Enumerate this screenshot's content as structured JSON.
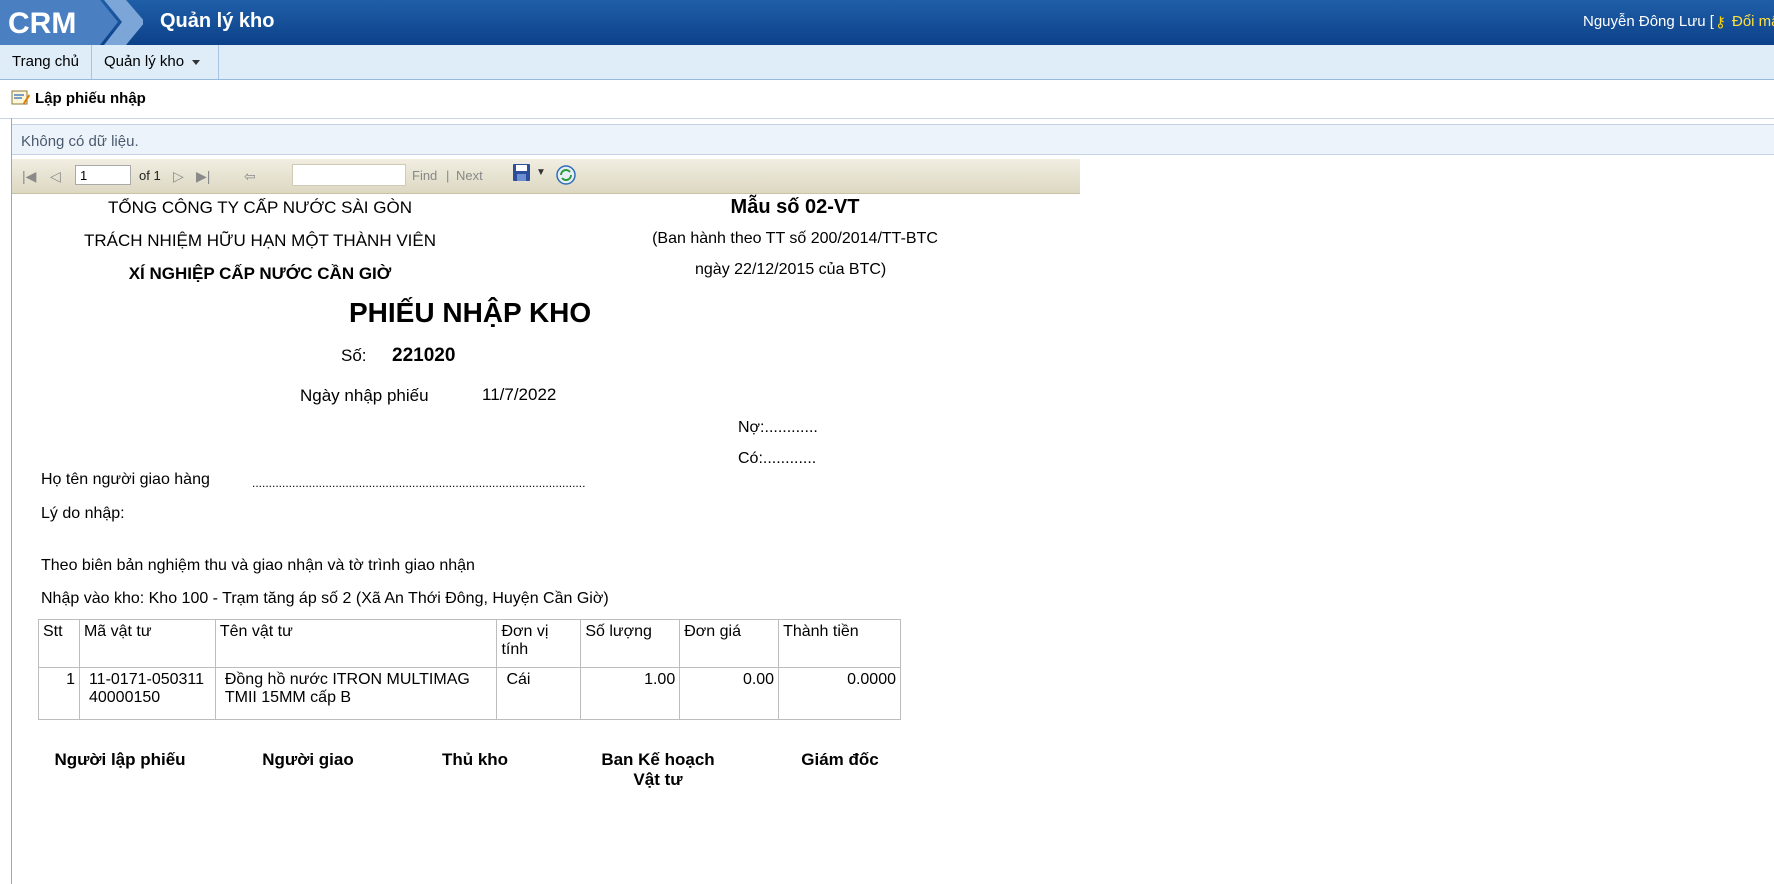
{
  "header": {
    "logo_text": "CRM",
    "app_title": "Quản lý kho",
    "user_name": "Nguyễn Đông Lưu [",
    "change_password": "Đổi mật khẩu"
  },
  "menu": {
    "home": "Trang chủ",
    "warehouse": "Quản lý kho"
  },
  "subbar": {
    "create_receipt": "Lập phiếu nhập"
  },
  "report_viewer": {
    "no_data": "Không có dữ liệu.",
    "page_value": "1",
    "of_pages": "of 1",
    "find": "Find",
    "separator": "|",
    "next": "Next"
  },
  "report": {
    "company_line1": "TỔNG CÔNG TY CẤP NƯỚC SÀI GÒN",
    "company_line2": "TRÁCH NHIỆM HỮU HẠN MỘT THÀNH VIÊN",
    "enterprise": "XÍ NGHIỆP CẤP NƯỚC CẦN GIỜ",
    "form_code": "Mẫu số 02-VT",
    "form_basis1": "(Ban hành theo TT số 200/2014/TT-BTC",
    "form_basis2": "ngày 22/12/2015 của BTC)",
    "title": "PHIẾU NHẬP KHO",
    "number_label": "Số:",
    "number_value": "221020",
    "date_label": "Ngày nhập phiếu",
    "date_value": "11/7/2022",
    "debit": "Nợ:............",
    "credit": "Có:............",
    "deliverer_label": "Họ tên người giao hàng",
    "deliverer_dots": "....................................................................................................",
    "reason_label": "Lý do nhập:",
    "basis_text": "Theo biên bản nghiệm thu và giao nhận và tờ trình giao nhận",
    "warehouse_text": "Nhập vào kho: Kho 100 - Trạm tăng áp số 2 (Xã An Thới Đông, Huyện Cần Giờ)",
    "table": {
      "headers": [
        "Stt",
        "Mã vật tư",
        "Tên vật tư",
        "Đơn vị tính",
        "Số lượng",
        "Đơn giá",
        "Thành tiền"
      ],
      "rows": [
        [
          "1",
          "11-0171-050311 40000150",
          "Đồng hồ nước ITRON MULTIMAG TMII 15MM cấp B",
          "Cái",
          "1.00",
          "0.00",
          "0.0000"
        ]
      ]
    },
    "signatures": [
      "Người lập phiếu",
      "Người giao",
      "Thủ kho",
      "Ban Kế hoạch Vật tư",
      "Giám đốc"
    ]
  },
  "colors": {
    "header_bg": "#0c4189",
    "menu_bg": "#dfedf9",
    "toolbar_bg": "#ddd8c2",
    "link_yellow": "#ffe040"
  }
}
